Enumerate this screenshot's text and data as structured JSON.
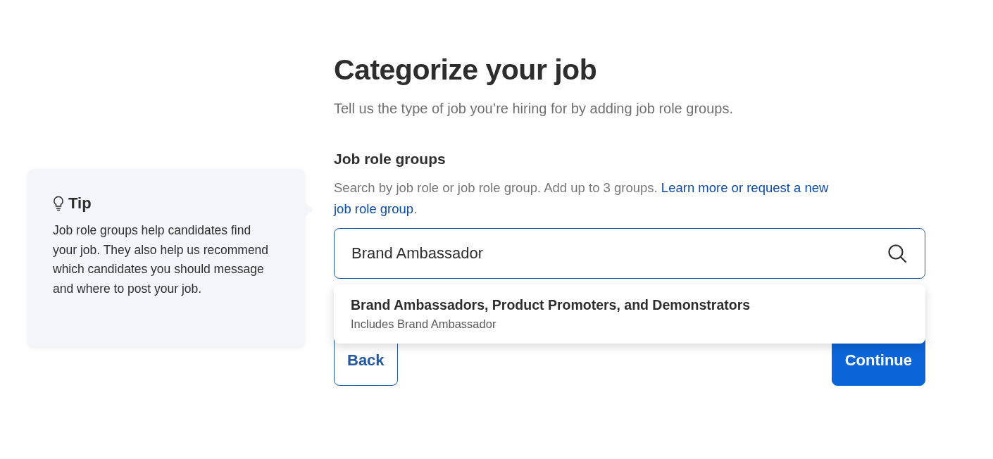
{
  "tip": {
    "title": "Tip",
    "body": "Job role groups help candidates find your job. They also help us recommend which candidates you should message and where to post your job."
  },
  "heading": "Categorize your job",
  "subtitle": "Tell us the type of job you’re hiring for by adding job role groups.",
  "field": {
    "label": "Job role groups",
    "help": "Search by job role or job role group. Add up to 3 groups.",
    "link_lines": [
      "Learn more or request a new",
      "job role group"
    ],
    "after_link": ".",
    "value": "Brand Ambassador"
  },
  "suggestions": [
    {
      "title": "Brand Ambassadors, Product Promoters, and Demonstrators",
      "detail": "Includes Brand Ambassador"
    }
  ],
  "buttons": [
    {
      "label": "Back",
      "kind": "secondary"
    },
    {
      "label": "Continue",
      "kind": "primary"
    }
  ]
}
